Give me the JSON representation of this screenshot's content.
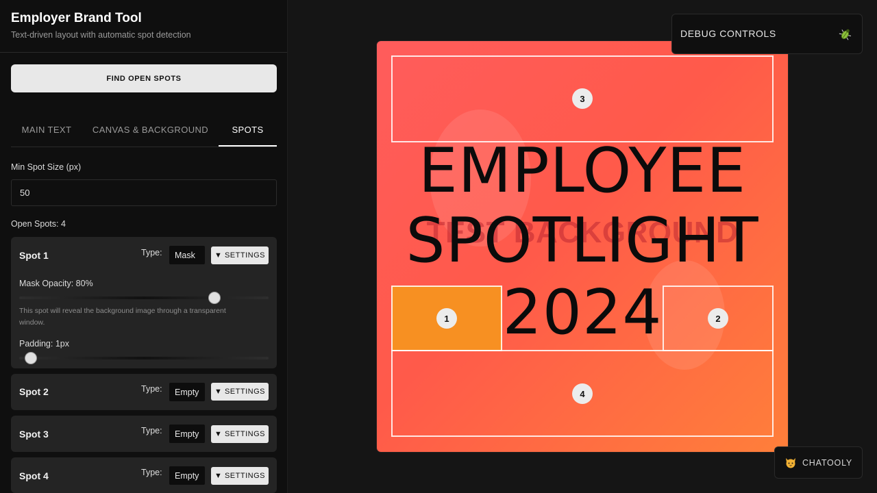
{
  "app": {
    "title": "Employer Brand Tool",
    "subtitle": "Text-driven layout with automatic spot detection"
  },
  "actions": {
    "find_open_spots": "FIND OPEN SPOTS"
  },
  "tabs": [
    {
      "label": "MAIN TEXT",
      "active": false
    },
    {
      "label": "CANVAS & BACKGROUND",
      "active": false
    },
    {
      "label": "SPOTS",
      "active": true
    }
  ],
  "min_spot": {
    "label": "Min Spot Size (px)",
    "value": "50"
  },
  "open_spots": "Open Spots: 4",
  "spots": [
    {
      "title": "Spot 1",
      "type_label": "Type:",
      "type_value": "Mask",
      "settings_label": "▼ SETTINGS",
      "expanded": true,
      "mask_opacity": {
        "label": "Mask Opacity: 80%",
        "value_percent": 80
      },
      "help": "This spot will reveal the background image through a transparent window.",
      "padding": {
        "label": "Padding: 1px",
        "value": 1
      }
    },
    {
      "title": "Spot 2",
      "type_label": "Type:",
      "type_value": "Empty",
      "settings_label": "▼ SETTINGS"
    },
    {
      "title": "Spot 3",
      "type_label": "Type:",
      "type_value": "Empty",
      "settings_label": "▼ SETTINGS"
    },
    {
      "title": "Spot 4",
      "type_label": "Type:",
      "type_value": "Empty",
      "settings_label": "▼ SETTINGS"
    }
  ],
  "canvas": {
    "background_text": "TEST BACKGROUND",
    "headline_lines": [
      "EMPLOYEE",
      "SPOTLIGHT",
      "2024"
    ],
    "spot_badges": [
      "1",
      "2",
      "3",
      "4"
    ],
    "colors": {
      "gradient_start": "#ff5c5c",
      "gradient_end": "#ff7f3a",
      "mask_fill": "#f79022"
    }
  },
  "debug": {
    "title": "DEBUG CONTROLS",
    "icon": "bug-icon"
  },
  "chatooly": {
    "label": "CHATOOLY",
    "icon": "cat-face-icon"
  }
}
